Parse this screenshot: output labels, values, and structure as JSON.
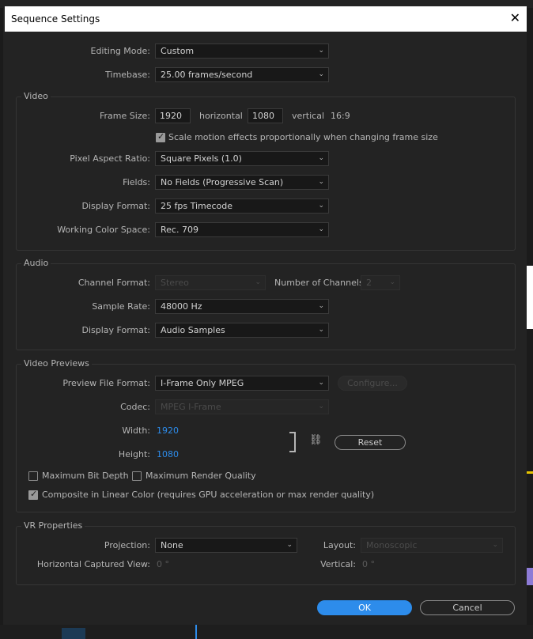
{
  "dialog": {
    "title": "Sequence Settings",
    "close_glyph": "✕"
  },
  "general": {
    "editing_mode_label": "Editing Mode:",
    "editing_mode_value": "Custom",
    "timebase_label": "Timebase:",
    "timebase_value": "25.00  frames/second"
  },
  "video": {
    "title": "Video",
    "frame_size_label": "Frame Size:",
    "width_value": "1920",
    "horizontal_label": "horizontal",
    "height_value": "1080",
    "vertical_label": "vertical",
    "aspect": "16:9",
    "scale_motion_label": "Scale motion effects proportionally when changing frame size",
    "scale_motion_checked": true,
    "pixel_aspect_label": "Pixel Aspect Ratio:",
    "pixel_aspect_value": "Square Pixels (1.0)",
    "fields_label": "Fields:",
    "fields_value": "No Fields (Progressive Scan)",
    "display_format_label": "Display Format:",
    "display_format_value": "25 fps Timecode",
    "color_space_label": "Working Color Space:",
    "color_space_value": "Rec. 709"
  },
  "audio": {
    "title": "Audio",
    "channel_format_label": "Channel Format:",
    "channel_format_value": "Stereo",
    "num_channels_label": "Number of Channels:",
    "num_channels_value": "2",
    "sample_rate_label": "Sample Rate:",
    "sample_rate_value": "48000 Hz",
    "display_format_label": "Display Format:",
    "display_format_value": "Audio Samples"
  },
  "previews": {
    "title": "Video Previews",
    "file_format_label": "Preview File Format:",
    "file_format_value": "I-Frame Only MPEG",
    "configure_label": "Configure...",
    "codec_label": "Codec:",
    "codec_value": "MPEG I-Frame",
    "width_label": "Width:",
    "width_value": "1920",
    "height_label": "Height:",
    "height_value": "1080",
    "reset_label": "Reset",
    "max_bit_depth_label": "Maximum Bit Depth",
    "max_bit_depth_checked": false,
    "max_render_quality_label": "Maximum Render Quality",
    "max_render_quality_checked": false,
    "composite_linear_label": "Composite in Linear Color (requires GPU acceleration or max render quality)",
    "composite_linear_checked": true
  },
  "vr": {
    "title": "VR Properties",
    "projection_label": "Projection:",
    "projection_value": "None",
    "layout_label": "Layout:",
    "layout_value": "Monoscopic",
    "h_captured_label": "Horizontal Captured View:",
    "h_captured_value": "0 °",
    "vertical_label": "Vertical:",
    "vertical_value": "0 °"
  },
  "footer": {
    "ok_label": "OK",
    "cancel_label": "Cancel"
  },
  "colors": {
    "accent": "#2d8ceb",
    "dialog_bg": "#232323",
    "field_bg": "#181818"
  }
}
